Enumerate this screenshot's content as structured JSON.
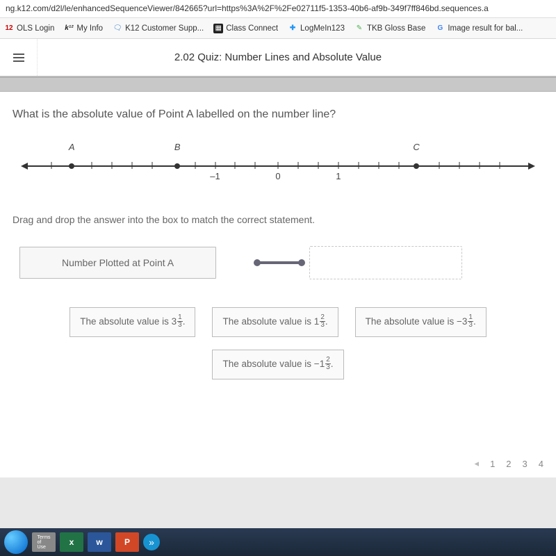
{
  "url": "ng.k12.com/d2l/le/enhancedSequenceViewer/842665?url=https%3A%2F%2Fe02711f5-1353-40b6-af9b-349f7ff846bd.sequences.a",
  "bookmarks": [
    {
      "label": "OLS Login"
    },
    {
      "label": "My Info"
    },
    {
      "label": "K12 Customer Supp..."
    },
    {
      "label": "Class Connect"
    },
    {
      "label": "LogMeIn123"
    },
    {
      "label": "TKB Gloss Base"
    },
    {
      "label": "Image result for bal..."
    }
  ],
  "quiz_title": "2.02 Quiz: Number Lines and Absolute Value",
  "question": "What is the absolute value of Point A labelled on the number line?",
  "numberline": {
    "labels": {
      "A": "A",
      "B": "B",
      "C": "C"
    },
    "nums": {
      "neg1": "–1",
      "zero": "0",
      "one": "1"
    }
  },
  "instruction": "Drag and drop the answer into the box to match the correct statement.",
  "drop_label": "Number Plotted at Point A",
  "choices": {
    "c1": {
      "prefix": "The absolute value is ",
      "whole": "3",
      "num": "1",
      "den": "3",
      "neg": false
    },
    "c2": {
      "prefix": "The absolute value is ",
      "whole": "1",
      "num": "2",
      "den": "3",
      "neg": false
    },
    "c3": {
      "prefix": "The absolute value is ",
      "whole": "3",
      "num": "1",
      "den": "3",
      "neg": true
    },
    "c4": {
      "prefix": "The absolute value is ",
      "whole": "1",
      "num": "2",
      "den": "3",
      "neg": true
    }
  },
  "pager": {
    "p1": "1",
    "p2": "2",
    "p3": "3",
    "p4": "4"
  }
}
